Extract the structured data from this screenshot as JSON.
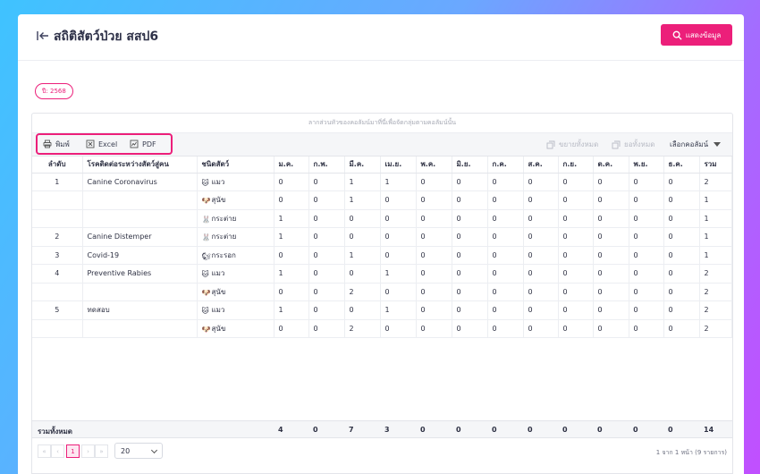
{
  "header": {
    "title": "สถิติสัตว์ป่วย สสป6",
    "show_button": "แสดงข้อมูล"
  },
  "filter": {
    "year_badge": "ปี: 2568"
  },
  "grid": {
    "group_hint": "ลากส่วนหัวของคอลัมน์มาที่นี่เพื่อจัดกลุ่มตามคอลัมน์นั้น",
    "toolbar": {
      "print": "พิมพ์",
      "excel": "Excel",
      "pdf": "PDF",
      "expand_all": "ขยายทั้งหมด",
      "collapse_all": "ยอทั้งหมด",
      "choose_columns": "เลือกคอลัมน์"
    },
    "columns": [
      "ลำดับ",
      "โรคติดต่อระหว่างสัตว์สู่คน",
      "ชนิดสัตว์",
      "ม.ค.",
      "ก.พ.",
      "มี.ค.",
      "เม.ย.",
      "พ.ค.",
      "มิ.ย.",
      "ก.ค.",
      "ส.ค.",
      "ก.ย.",
      "ต.ค.",
      "พ.ย.",
      "ธ.ค.",
      "รวม"
    ],
    "rows": [
      {
        "no": "1",
        "disease": "Canine Coronavirus",
        "animal": "แมว",
        "icon": "cat-icon",
        "values": [
          "0",
          "0",
          "1",
          "1",
          "0",
          "0",
          "0",
          "0",
          "0",
          "0",
          "0",
          "0",
          "2"
        ]
      },
      {
        "no": "",
        "disease": "",
        "animal": "สุนัข",
        "icon": "dog-icon",
        "values": [
          "0",
          "0",
          "1",
          "0",
          "0",
          "0",
          "0",
          "0",
          "0",
          "0",
          "0",
          "0",
          "1"
        ]
      },
      {
        "no": "",
        "disease": "",
        "animal": "กระต่าย",
        "icon": "rabbit-icon",
        "values": [
          "1",
          "0",
          "0",
          "0",
          "0",
          "0",
          "0",
          "0",
          "0",
          "0",
          "0",
          "0",
          "1"
        ]
      },
      {
        "no": "2",
        "disease": "Canine Distemper",
        "animal": "กระต่าย",
        "icon": "rabbit-icon",
        "values": [
          "1",
          "0",
          "0",
          "0",
          "0",
          "0",
          "0",
          "0",
          "0",
          "0",
          "0",
          "0",
          "1"
        ]
      },
      {
        "no": "3",
        "disease": "Covid-19",
        "animal": "กระรอก",
        "icon": "squirrel-icon",
        "values": [
          "0",
          "0",
          "1",
          "0",
          "0",
          "0",
          "0",
          "0",
          "0",
          "0",
          "0",
          "0",
          "1"
        ]
      },
      {
        "no": "4",
        "disease": "Preventive Rabies",
        "animal": "แมว",
        "icon": "cat-icon",
        "values": [
          "1",
          "0",
          "0",
          "1",
          "0",
          "0",
          "0",
          "0",
          "0",
          "0",
          "0",
          "0",
          "2"
        ]
      },
      {
        "no": "",
        "disease": "",
        "animal": "สุนัข",
        "icon": "dog-icon",
        "values": [
          "0",
          "0",
          "2",
          "0",
          "0",
          "0",
          "0",
          "0",
          "0",
          "0",
          "0",
          "0",
          "2"
        ]
      },
      {
        "no": "5",
        "disease": "ทดสอบ",
        "animal": "แมว",
        "icon": "cat-icon",
        "values": [
          "1",
          "0",
          "0",
          "1",
          "0",
          "0",
          "0",
          "0",
          "0",
          "0",
          "0",
          "0",
          "2"
        ]
      },
      {
        "no": "",
        "disease": "",
        "animal": "สุนัข",
        "icon": "dog-icon",
        "values": [
          "0",
          "0",
          "2",
          "0",
          "0",
          "0",
          "0",
          "0",
          "0",
          "0",
          "0",
          "0",
          "2"
        ]
      }
    ],
    "footer": {
      "label": "รวมทั้งหมด",
      "totals": [
        "4",
        "0",
        "7",
        "3",
        "0",
        "0",
        "0",
        "0",
        "0",
        "0",
        "0",
        "0",
        "14"
      ]
    }
  },
  "pager": {
    "current_page": "1",
    "page_size": "20",
    "info": "1 จาก 1 หน้า (9 รายการ)"
  },
  "icons": {
    "cat-icon": "🐱",
    "dog-icon": "🐶",
    "rabbit-icon": "🐰",
    "squirrel-icon": "🐿"
  },
  "colors": {
    "accent": "#ec1f7a"
  }
}
